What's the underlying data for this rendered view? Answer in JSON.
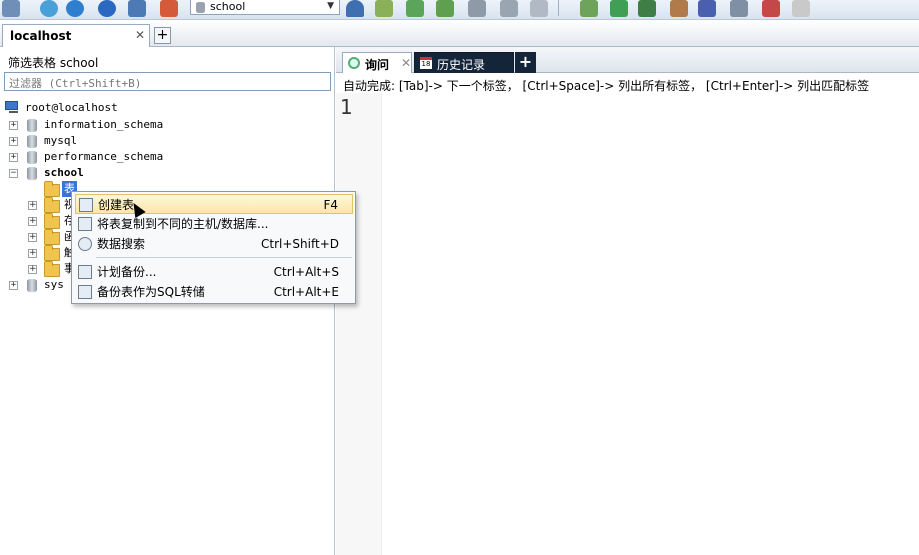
{
  "toolbar": {
    "database_selector": "school",
    "icons": [
      "backup-icon",
      "new-connection-icon",
      "query-icon",
      "execute-icon",
      "stop-icon",
      "refresh-icon",
      "dropdown-db-icon",
      "import-icon",
      "export-icon",
      "sync-icon",
      "schema-icon",
      "table-data-icon",
      "report-icon",
      "user-icon",
      "designer-icon",
      "scheduler-icon",
      "email-icon",
      "monitor-icon",
      "tools-icon",
      "compare-icon"
    ]
  },
  "connection_tabs": [
    {
      "label": "localhost"
    }
  ],
  "left_panel": {
    "filter_label": "筛选表格 school",
    "filter_placeholder": "过滤器 (Ctrl+Shift+B)",
    "tree": {
      "root": "root@localhost",
      "databases": [
        "information_schema",
        "mysql",
        "performance_schema",
        "school",
        "sys"
      ],
      "school_children": [
        "表",
        "视",
        "存",
        "函",
        "触",
        "事"
      ]
    }
  },
  "query_tabs": [
    {
      "label": "询问"
    },
    {
      "label": "历史记录"
    }
  ],
  "autocomplete_hint": "自动完成: [Tab]-> 下一个标签， [Ctrl+Space]-> 列出所有标签， [Ctrl+Enter]-> 列出匹配标签",
  "editor": {
    "line_number": "1"
  },
  "context_menu": {
    "items": [
      {
        "label": "创建表",
        "shortcut": "F4",
        "icon": "create-table-icon"
      },
      {
        "label": "将表复制到不同的主机/数据库...",
        "shortcut": "",
        "icon": "copy-table-icon"
      },
      {
        "label": "数据搜索",
        "shortcut": "Ctrl+Shift+D",
        "icon": "search-icon"
      },
      {
        "label": "计划备份...",
        "shortcut": "Ctrl+Alt+S",
        "icon": "schedule-backup-icon"
      },
      {
        "label": "备份表作为SQL转储",
        "shortcut": "Ctrl+Alt+E",
        "icon": "sql-dump-icon"
      }
    ]
  }
}
